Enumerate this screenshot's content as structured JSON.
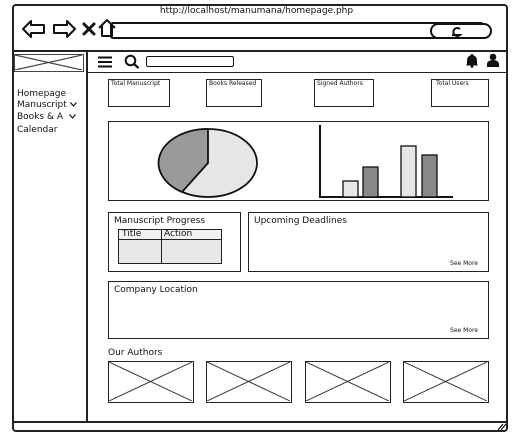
{
  "browser": {
    "url": "http://localhost/manumana/homepage.php"
  },
  "sidebar": {
    "items": [
      {
        "label": "Homepage",
        "has_dropdown": false
      },
      {
        "label": "Manuscript",
        "has_dropdown": true
      },
      {
        "label": "Books & A",
        "has_dropdown": true
      },
      {
        "label": "Calendar",
        "has_dropdown": false
      }
    ]
  },
  "topbar": {
    "search_value": ""
  },
  "stats": [
    {
      "label": "Total Manuscript"
    },
    {
      "label": "Books Released"
    },
    {
      "label": "Signed Authors"
    },
    {
      "label": "Total Users"
    }
  ],
  "charts": {
    "pie_colors": [
      "#9a9a9a",
      "#e6e6e6"
    ],
    "bar_colors": [
      "#e6e6e6",
      "#888888"
    ]
  },
  "manuscript_progress": {
    "title": "Manuscript Progress",
    "columns": [
      "Title",
      "Action"
    ]
  },
  "upcoming_deadlines": {
    "title": "Upcoming Deadlines",
    "see_more": "See More"
  },
  "company_location": {
    "title": "Company Location",
    "see_more": "See More"
  },
  "authors": {
    "title": "Our Authors"
  }
}
